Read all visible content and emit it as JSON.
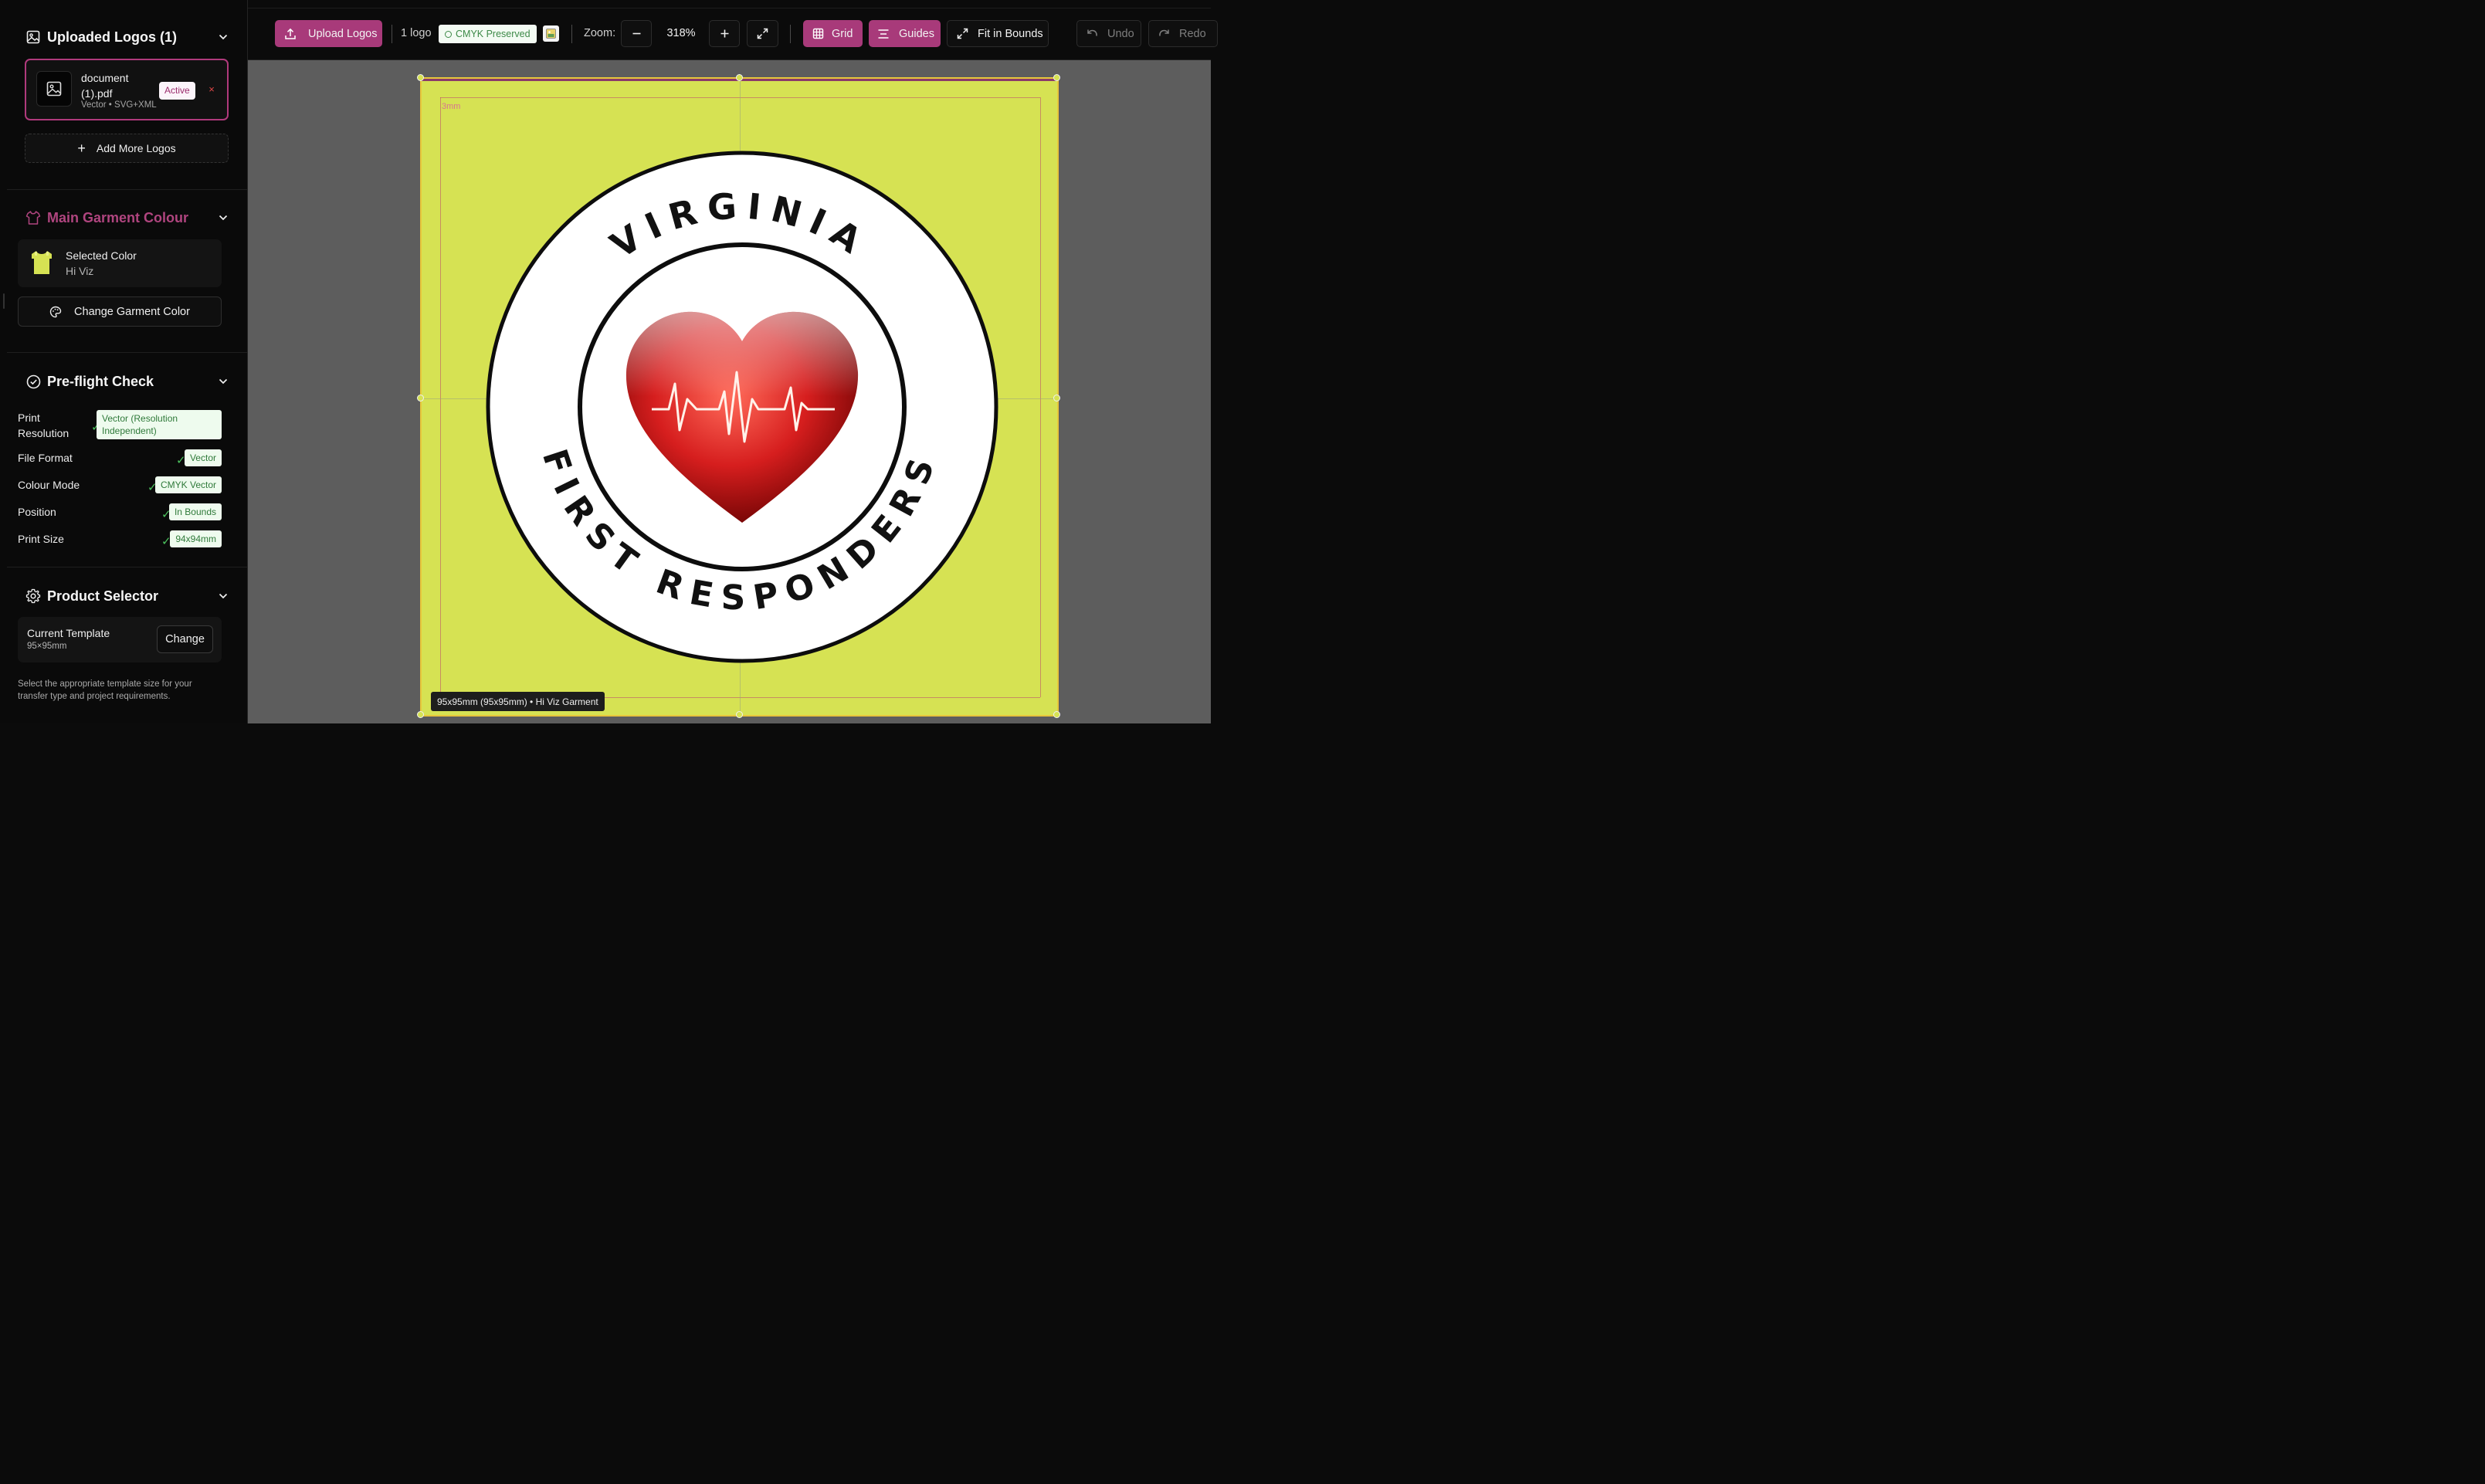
{
  "sidebar": {
    "uploaded": {
      "title": "Uploaded Logos (1)",
      "file": {
        "name": "document (1).pdf",
        "meta": "Vector • SVG+XML",
        "status": "Active",
        "remove": "×"
      },
      "add_more": "Add More Logos"
    },
    "garment": {
      "title": "Main Garment Colour",
      "selected_label": "Selected Color",
      "selected_value": "Hi Viz",
      "swatch_color": "#d6e253",
      "change_button": "Change Garment Color"
    },
    "preflight": {
      "title": "Pre-flight Check",
      "rows": [
        {
          "label": "Print Resolution",
          "check": "✓",
          "badge": "Vector (Resolution Independent)"
        },
        {
          "label": "File Format",
          "check": "✓",
          "badge": "Vector"
        },
        {
          "label": "Colour Mode",
          "check": "✓",
          "badge": "CMYK Vector"
        },
        {
          "label": "Position",
          "check": "✓",
          "badge": "In Bounds"
        },
        {
          "label": "Print Size",
          "check": "✓",
          "badge": "94x94mm"
        }
      ]
    },
    "product": {
      "title": "Product Selector",
      "template_label": "Current Template",
      "template_value": "95×95mm",
      "change_button": "Change",
      "help": "Select the appropriate template size for your transfer type and project requirements."
    }
  },
  "toolbar": {
    "upload": "Upload Logos",
    "logo_count": "1 logo",
    "cmyk": "CMYK Preserved",
    "zoom_label": "Zoom:",
    "zoom_value": "318%",
    "grid": "Grid",
    "guides": "Guides",
    "fit": "Fit in Bounds",
    "undo": "Undo",
    "redo": "Redo"
  },
  "canvas": {
    "bleed_label": "3mm",
    "info": "95x95mm (95x95mm) • Hi Viz Garment",
    "logo_top_text": "VIRGINIA",
    "logo_bottom_text": "FIRST RESPONDERS",
    "artboard_color": "#d6e253"
  },
  "colors": {
    "accent": "#a83a7a",
    "success": "#4cc35e"
  }
}
